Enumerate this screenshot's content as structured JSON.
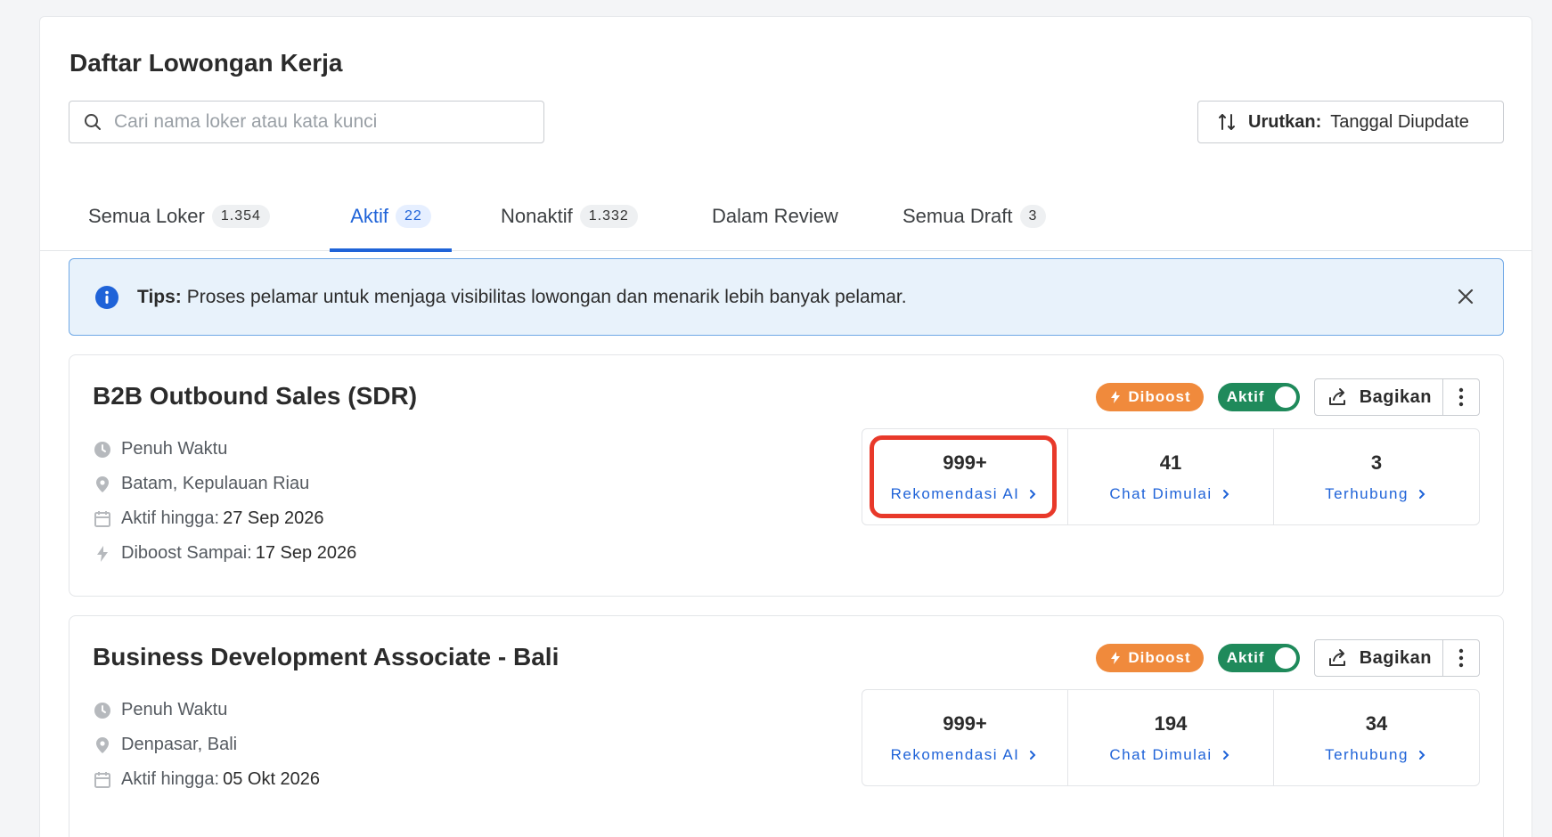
{
  "page": {
    "title": "Daftar Lowongan Kerja",
    "search_placeholder": "Cari nama loker atau kata kunci",
    "sort_label": "Urutkan:",
    "sort_value": "Tanggal Diupdate"
  },
  "tabs": [
    {
      "label": "Semua Loker",
      "count": "1.354"
    },
    {
      "label": "Aktif",
      "count": "22"
    },
    {
      "label": "Nonaktif",
      "count": "1.332"
    },
    {
      "label": "Dalam Review",
      "count": ""
    },
    {
      "label": "Semua Draft",
      "count": "3"
    }
  ],
  "tips": {
    "label": "Tips:",
    "text": "Proses pelamar untuk menjaga visibilitas lowongan dan menarik lebih banyak pelamar."
  },
  "jobs": [
    {
      "title": "B2B Outbound Sales (SDR)",
      "boost_label": "Diboost",
      "status_label": "Aktif",
      "share_label": "Bagikan",
      "type": "Penuh Waktu",
      "location": "Batam, Kepulauan Riau",
      "active_until_label": "Aktif hingga:",
      "active_until": "27 Sep 2026",
      "boost_until_label": "Diboost Sampai:",
      "boost_until": "17 Sep 2026",
      "stats": [
        {
          "value": "999+",
          "label": "Rekomendasi AI"
        },
        {
          "value": "41",
          "label": "Chat Dimulai"
        },
        {
          "value": "3",
          "label": "Terhubung"
        }
      ]
    },
    {
      "title": "Business Development Associate - Bali",
      "boost_label": "Diboost",
      "status_label": "Aktif",
      "share_label": "Bagikan",
      "type": "Penuh Waktu",
      "location": "Denpasar, Bali",
      "active_until_label": "Aktif hingga:",
      "active_until": "05 Okt 2026",
      "stats": [
        {
          "value": "999+",
          "label": "Rekomendasi AI"
        },
        {
          "value": "194",
          "label": "Chat Dimulai"
        },
        {
          "value": "34",
          "label": "Terhubung"
        }
      ]
    }
  ],
  "icons": {
    "search": "search-icon",
    "sort": "sort-arrows-icon",
    "info": "info-icon",
    "close": "close-icon",
    "clock": "clock-icon",
    "location": "location-pin-icon",
    "calendar": "calendar-icon",
    "bolt": "lightning-icon",
    "share": "share-icon",
    "more": "more-vertical-icon",
    "chevron": "chevron-right-icon"
  },
  "colors": {
    "primary": "#1f63d8",
    "boost": "#f08a3c",
    "active": "#1f8a5b",
    "highlight": "#e8392a",
    "tips_bg": "#e8f2fb"
  }
}
